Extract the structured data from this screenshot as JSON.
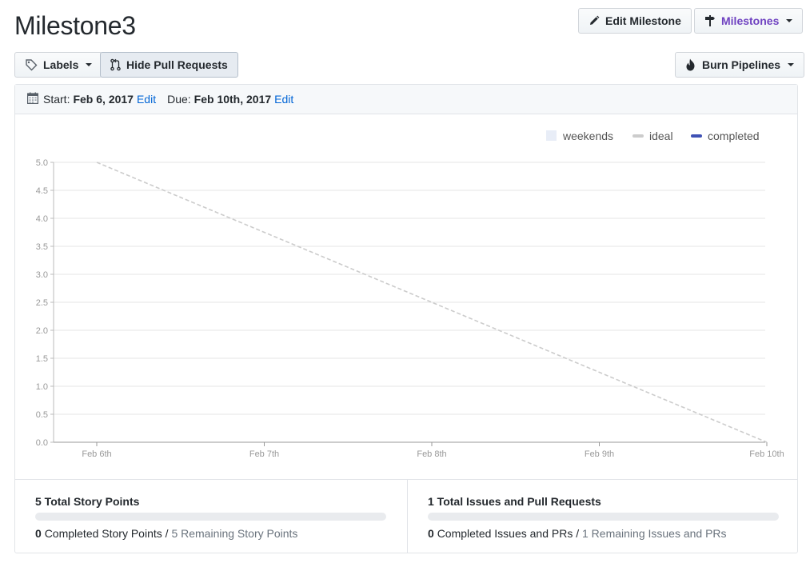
{
  "page": {
    "title": "Milestone3"
  },
  "toolbar": {
    "edit_label": "Edit Milestone",
    "milestones_label": "Milestones",
    "labels_label": "Labels",
    "hide_prs_label": "Hide Pull Requests",
    "burn_label": "Burn Pipelines"
  },
  "dates": {
    "start_label": "Start:",
    "start_value": "Feb 6, 2017",
    "start_edit": "Edit",
    "due_label": "Due:",
    "due_value": "Feb 10th, 2017",
    "due_edit": "Edit"
  },
  "colors": {
    "weekends": "#e8edf7",
    "ideal": "#cccccc",
    "completed": "#3f51b5",
    "link": "#0366d6",
    "milestones": "#6f42c1"
  },
  "chart_data": {
    "type": "line",
    "x": [
      "Feb 6th",
      "Feb 7th",
      "Feb 8th",
      "Feb 9th",
      "Feb 10th"
    ],
    "y_ticks": [
      "0.0",
      "0.5",
      "1.0",
      "1.5",
      "2.0",
      "2.5",
      "3.0",
      "3.5",
      "4.0",
      "4.5",
      "5.0"
    ],
    "ylim": [
      0,
      5
    ],
    "grid": true,
    "legend_position": "top-right",
    "legend": [
      "weekends",
      "ideal",
      "completed"
    ],
    "series": [
      {
        "name": "ideal",
        "style": "dashed",
        "values": [
          5.0,
          3.75,
          2.5,
          1.25,
          0.0
        ]
      },
      {
        "name": "completed",
        "values": []
      }
    ]
  },
  "stats": {
    "points": {
      "title": "5 Total Story Points",
      "completed_count": "0",
      "completed_text": "Completed Story Points /",
      "remaining_text": "5 Remaining Story Points",
      "progress": 0
    },
    "issues": {
      "title": "1 Total Issues and Pull Requests",
      "completed_count": "0",
      "completed_text": "Completed Issues and PRs /",
      "remaining_text": "1 Remaining Issues and PRs",
      "progress": 0
    }
  }
}
